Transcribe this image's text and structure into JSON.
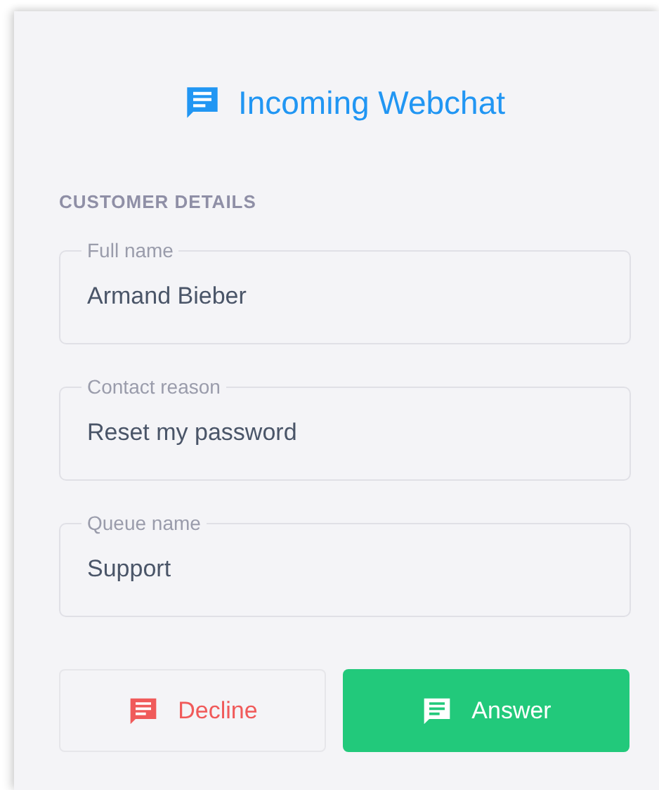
{
  "header": {
    "title": "Incoming Webchat"
  },
  "section": {
    "title": "CUSTOMER DETAILS"
  },
  "fields": [
    {
      "label": "Full name",
      "value": "Armand Bieber"
    },
    {
      "label": "Contact reason",
      "value": "Reset my password"
    },
    {
      "label": "Queue name",
      "value": "Support"
    }
  ],
  "buttons": [
    {
      "label": "Decline",
      "kind": "decline"
    },
    {
      "label": "Answer",
      "kind": "answer"
    }
  ]
}
